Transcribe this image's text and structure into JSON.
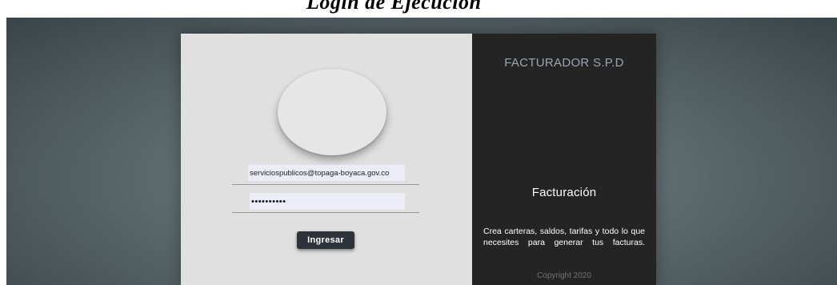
{
  "header": {
    "caption": "Login de Ejecución"
  },
  "login_form": {
    "email_value": "serviciospublicos@topaga-boyaca.gov.co",
    "password_value": "••••••••••",
    "submit_label": "Ingresar"
  },
  "info_panel": {
    "app_title": "FACTURADOR S.P.D",
    "section_title": "Facturación",
    "description": "Crea carteras, saldos, tarifas y todo lo que necesites para generar tus facturas.",
    "copyright": "Copyright 2020"
  },
  "colors": {
    "left_panel_bg": "#e0e0e0",
    "right_panel_bg": "#242424",
    "button_bg": "#2d3338",
    "app_title_color": "#9aa7b2"
  },
  "icons": {
    "avatar": "avatar-circle"
  }
}
